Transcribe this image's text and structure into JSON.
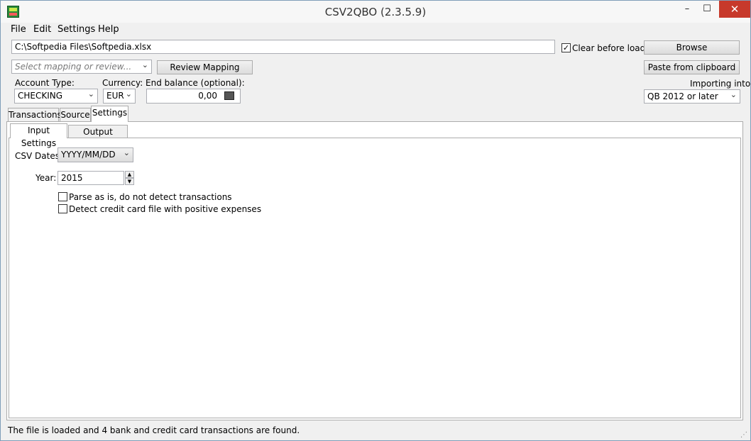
{
  "window": {
    "title": "CSV2QBO (2.3.5.9)",
    "icon": "app-icon",
    "controls": {
      "minimize": "–",
      "maximize": "☐",
      "close": "✕"
    }
  },
  "menu": [
    "File",
    "Edit",
    "Settings",
    "Help"
  ],
  "file": {
    "path": "C:\\Softpedia Files\\Softpedia.xlsx",
    "clear_before_load_label": "Clear before load",
    "clear_before_load_checked": true,
    "browse_label": "Browse"
  },
  "mapping": {
    "placeholder": "Select mapping or review...",
    "review_label": "Review Mapping",
    "paste_label": "Paste from clipboard"
  },
  "account": {
    "type_label": "Account Type:",
    "type_value": "CHECKING",
    "currency_label": "Currency:",
    "currency_value": "EUR",
    "balance_label": "End balance (optional):",
    "balance_value": "0,00",
    "importing_label": "Importing into:",
    "importing_value": "QB 2012 or later"
  },
  "tabs": [
    "Transactions",
    "Source",
    "Settings"
  ],
  "subtabs": [
    "Input Settings",
    "Output Settings"
  ],
  "settings": {
    "csv_dates_label": "CSV Dates:",
    "csv_dates_value": "YYYY/MM/DD",
    "year_label": "Year:",
    "year_value": "2015",
    "parse_as_is_label": "Parse as is, do not detect transactions",
    "parse_as_is_checked": false,
    "detect_cc_label": "Detect credit card file with positive expenses",
    "detect_cc_checked": false
  },
  "status": "The file is loaded and 4 bank and credit card transactions are found."
}
